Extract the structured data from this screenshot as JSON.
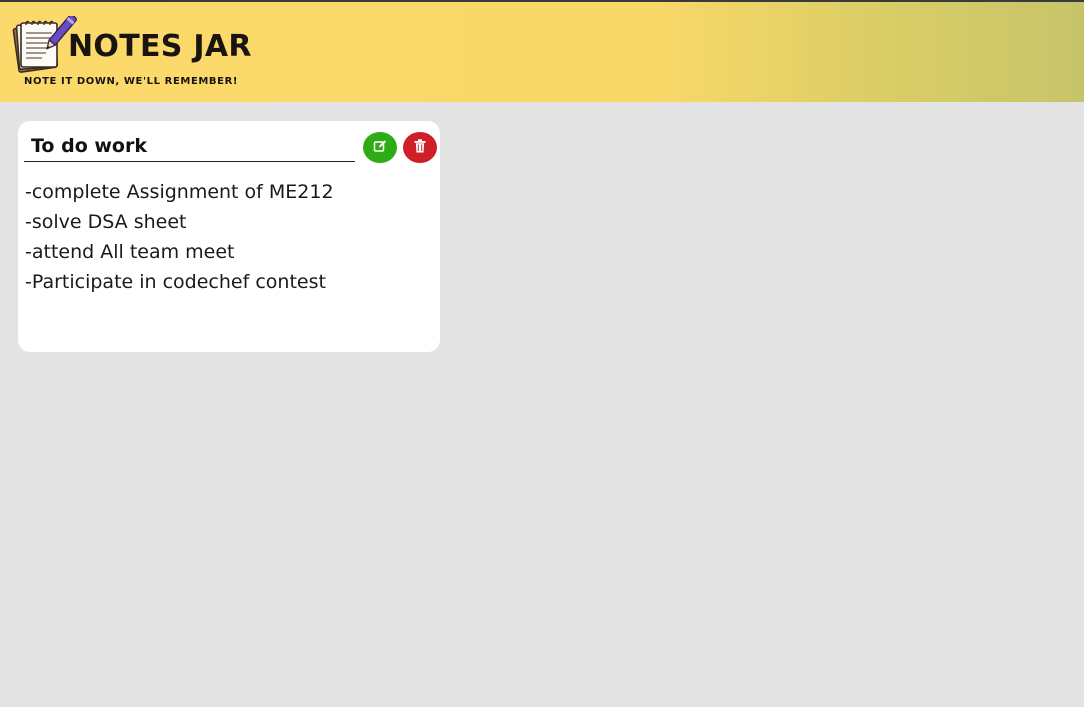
{
  "app": {
    "brand": {
      "title": "NOTES JAR",
      "tagline": "NOTE IT DOWN, WE'LL REMEMBER!",
      "logo_icon": "notepad-pen-icon"
    },
    "colors": {
      "header_start": "#fbd96a",
      "header_end": "#c6c46a",
      "page_background": "#e3e3e3",
      "edit_button": "#2eac16",
      "delete_button": "#cf1f26"
    }
  },
  "notes": [
    {
      "title": "To do work",
      "lines": [
        "-complete Assignment of ME212",
        "-solve DSA sheet",
        "-attend All team meet",
        "-Participate in codechef contest"
      ],
      "edit_icon": "edit-icon",
      "delete_icon": "trash-icon"
    }
  ]
}
